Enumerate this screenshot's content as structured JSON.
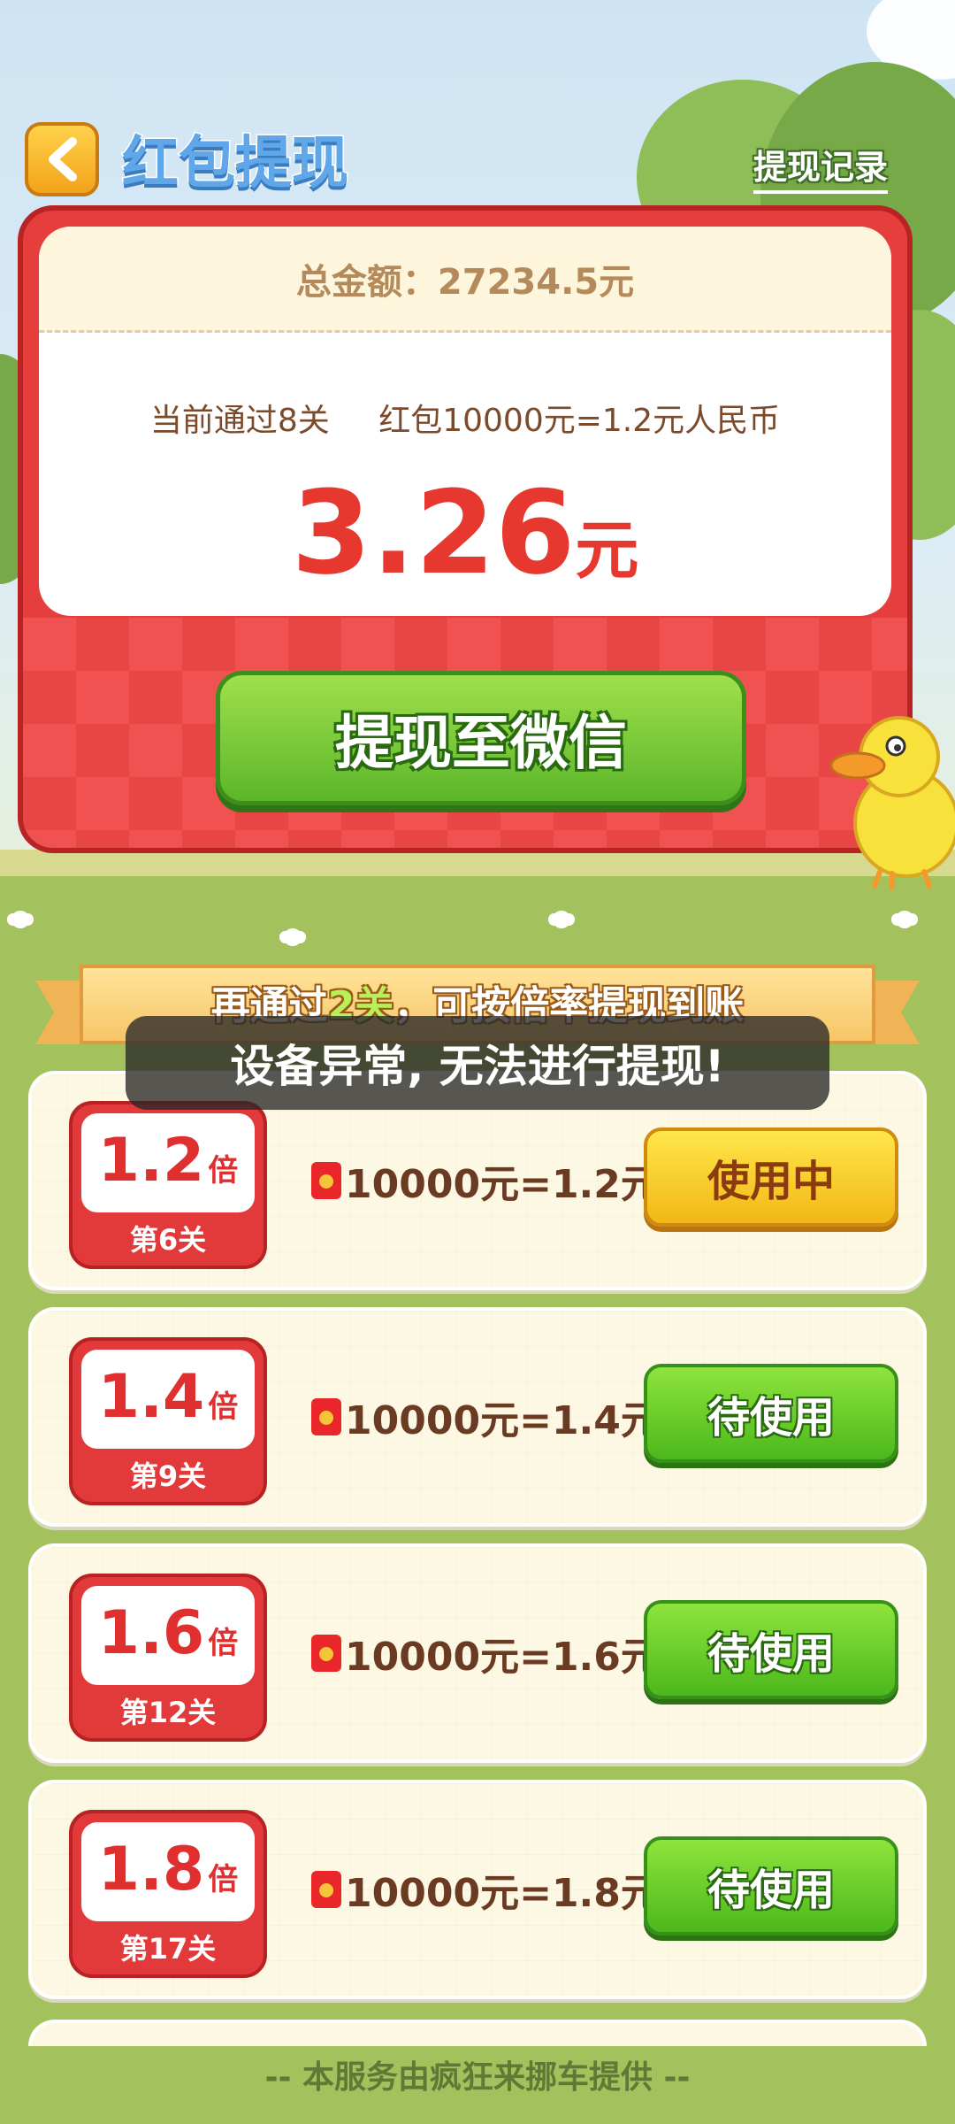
{
  "header": {
    "title": "红包提现",
    "record_link": "提现记录"
  },
  "card": {
    "total_label": "总金额：27234.5元",
    "progress_text": "当前通过8关",
    "rate_text": "红包10000元=1.2元人民币",
    "amount": "3.26",
    "amount_unit": "元",
    "withdraw_button": "提现至微信"
  },
  "ribbon": {
    "prefix": "再通过",
    "count": "2关",
    "suffix": "，可按倍率提现到账"
  },
  "toast": "设备异常, 无法进行提现!",
  "rates": [
    {
      "multiplier": "1.2",
      "bei": "倍",
      "level": "第6关",
      "rate": "10000元=1.2元",
      "button": "使用中",
      "state": "in-use"
    },
    {
      "multiplier": "1.4",
      "bei": "倍",
      "level": "第9关",
      "rate": "10000元=1.4元",
      "button": "待使用",
      "state": "pending"
    },
    {
      "multiplier": "1.6",
      "bei": "倍",
      "level": "第12关",
      "rate": "10000元=1.6元",
      "button": "待使用",
      "state": "pending"
    },
    {
      "multiplier": "1.8",
      "bei": "倍",
      "level": "第17关",
      "rate": "10000元=1.8元",
      "button": "待使用",
      "state": "pending"
    }
  ],
  "footer": "-- 本服务由疯狂来挪车提供 --",
  "colors": {
    "accent_red": "#e63d3d",
    "button_green": "#5cb62a",
    "button_yellow": "#f2b816",
    "grass": "#a3c15d"
  }
}
